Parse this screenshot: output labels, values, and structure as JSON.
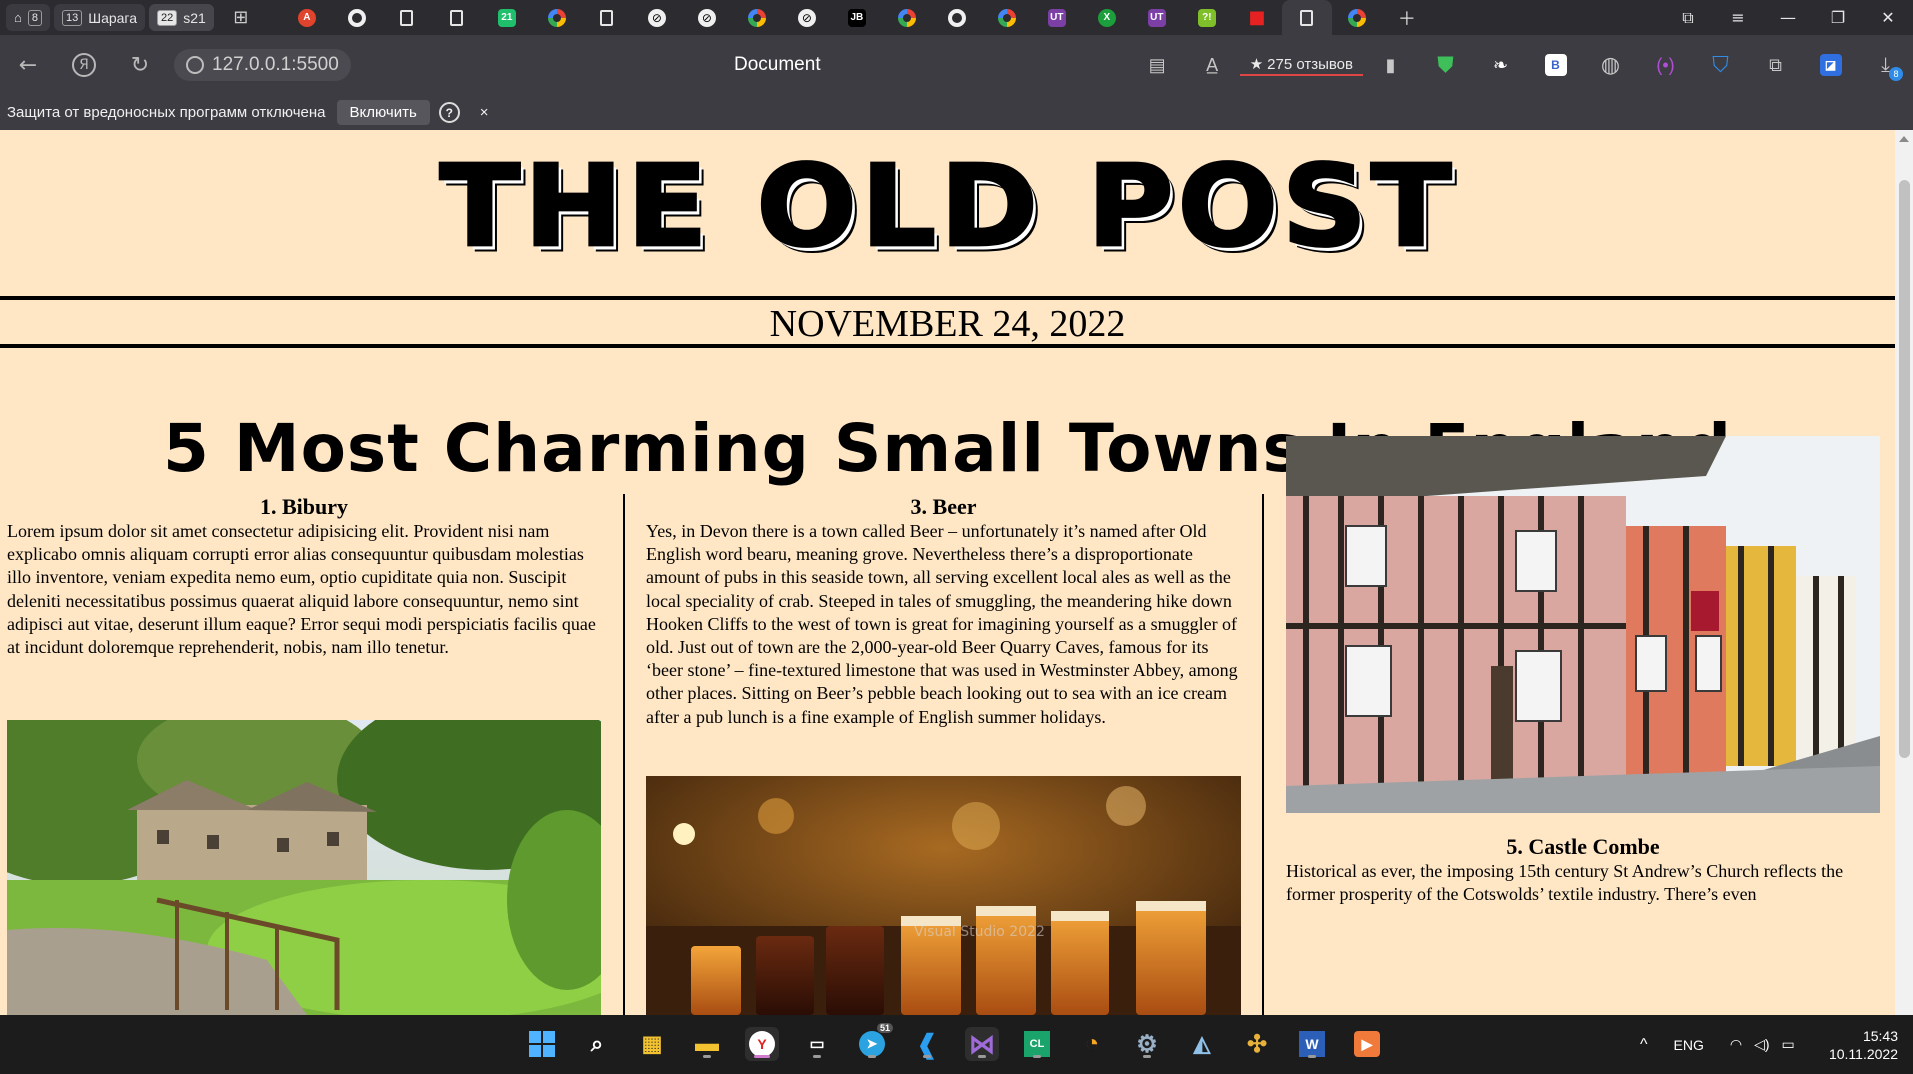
{
  "browser": {
    "tab_group_1": {
      "count": "8"
    },
    "tab_group_2": {
      "count": "13",
      "label": "Шарага"
    },
    "tab_group_3": {
      "count": "22",
      "label": "s21"
    },
    "address": "127.0.0.1:5500",
    "page_title": "Document",
    "rating_label": "275 отзывов",
    "download_badge": "8",
    "extension_letters": {
      "jb": "JB",
      "ut": "UT",
      "b": "B",
      "x": "X"
    }
  },
  "protection_bar": {
    "message": "Защита от вредоносных программ отключена",
    "enable_label": "Включить",
    "help_label": "?",
    "close_label": "×"
  },
  "page": {
    "masthead": "THE OLD POST",
    "date": "NOVEMBER 24, 2022",
    "headline": "5 Most Charming Small Towns In England",
    "columns": [
      {
        "heading": "1. Bibury",
        "text": "Lorem ipsum dolor sit amet consectetur adipisicing elit. Provident nisi nam explicabo omnis aliquam corrupti error alias consequuntur quibusdam molestias illo inventore, veniam expedita nemo eum, optio cupiditate quia non. Suscipit deleniti necessitatibus possimus quaerat aliquid labore consequuntur, nemo sint adipisci aut vitae, deserunt illum eaque? Error sequi modi perspiciatis facilis quae at incidunt doloremque reprehenderit, nobis, nam illo tenetur."
      },
      {
        "heading": "3. Beer",
        "text": "Yes, in Devon there is a town called Beer – unfortunately it’s named after Old English word bearu, meaning grove. Nevertheless there’s a disproportionate amount of pubs in this seaside town, all serving excellent local ales as well as the local speciality of crab. Steeped in tales of smuggling, the meandering hike down Hooken Cliffs to the west of town is great for imagining yourself as a smuggler of old. Just out of town are the 2,000-year-old Beer Quarry Caves, famous for its ‘beer stone’ – fine-textured limestone that was used in Westminster Abbey, among other places. Sitting on Beer’s pebble beach looking out to sea with an ice cream after a pub lunch is a fine example of English summer holidays."
      },
      {
        "heading": "5. Castle Combe",
        "text": "Historical as ever, the imposing 15th century St Andrew’s Church reflects the former prosperity of the Cotswolds’ textile industry. There’s even"
      }
    ],
    "watermark": "Visual Studio 2022"
  },
  "taskbar": {
    "telegram_badge": "51",
    "language": "ENG",
    "time": "15:43",
    "date": "10.11.2022",
    "tray_chevron": "^"
  },
  "colors": {
    "page_background": "#ffe7c6",
    "browser_chrome": "#3c3c42",
    "tab_strip": "#2b2b30",
    "taskbar": "#1c1c1c"
  }
}
